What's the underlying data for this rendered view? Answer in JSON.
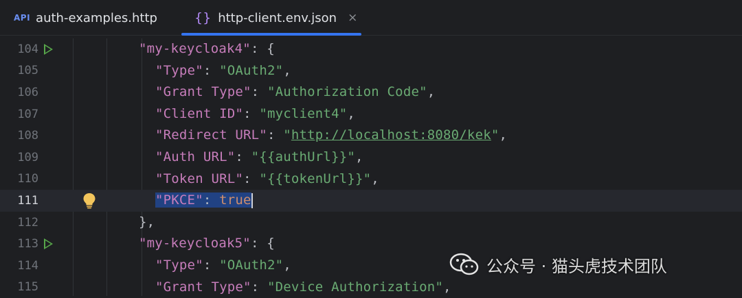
{
  "tabs": [
    {
      "label": "auth-examples.http",
      "icon": "api-file-icon",
      "icon_text": "API",
      "active": false
    },
    {
      "label": "http-client.env.json",
      "icon": "json-file-icon",
      "icon_text": "{}",
      "active": true,
      "close": "×"
    }
  ],
  "editor": {
    "current_line": 111,
    "lines": [
      {
        "n": "104",
        "run": true
      },
      {
        "n": "105"
      },
      {
        "n": "106"
      },
      {
        "n": "107"
      },
      {
        "n": "108"
      },
      {
        "n": "109"
      },
      {
        "n": "110"
      },
      {
        "n": "111",
        "bulb": true
      },
      {
        "n": "112"
      },
      {
        "n": "113",
        "run": true
      },
      {
        "n": "114"
      },
      {
        "n": "115"
      }
    ],
    "code": {
      "l104": {
        "key": "\"my-keycloak4\"",
        "rest": ": {"
      },
      "l105": {
        "key": "\"Type\"",
        "sep": ": ",
        "val": "\"OAuth2\"",
        "end": ","
      },
      "l106": {
        "key": "\"Grant Type\"",
        "sep": ": ",
        "val": "\"Authorization Code\"",
        "end": ","
      },
      "l107": {
        "key": "\"Client ID\"",
        "sep": ": ",
        "val": "\"myclient4\"",
        "end": ","
      },
      "l108": {
        "key": "\"Redirect URL\"",
        "sep": ": ",
        "q1": "\"",
        "url": "http://localhost:8080/kek",
        "q2": "\"",
        "end": ","
      },
      "l109": {
        "key": "\"Auth URL\"",
        "sep": ": ",
        "val": "\"{{authUrl}}\"",
        "end": ","
      },
      "l110": {
        "key": "\"Token URL\"",
        "sep": ": ",
        "val": "\"{{tokenUrl}}\"",
        "end": ","
      },
      "l111": {
        "key": "\"PKCE\"",
        "sep": ": ",
        "val": "true"
      },
      "l112": {
        "text": "},"
      },
      "l113": {
        "key": "\"my-keycloak5\"",
        "rest": ": {"
      },
      "l114": {
        "key": "\"Type\"",
        "sep": ": ",
        "val": "\"OAuth2\"",
        "end": ","
      },
      "l115": {
        "key": "\"Grant Type\"",
        "sep": ": ",
        "val": "\"Device Authorization\"",
        "end": ","
      }
    }
  },
  "watermark": {
    "text": "公众号 · 猫头虎技术团队",
    "icon": "wechat-icon"
  },
  "colors": {
    "background": "#1e1f22",
    "key": "#c77dbb",
    "string": "#6aab73",
    "keyword": "#cf8e6d",
    "selection": "#214283",
    "accent": "#3574f0"
  }
}
